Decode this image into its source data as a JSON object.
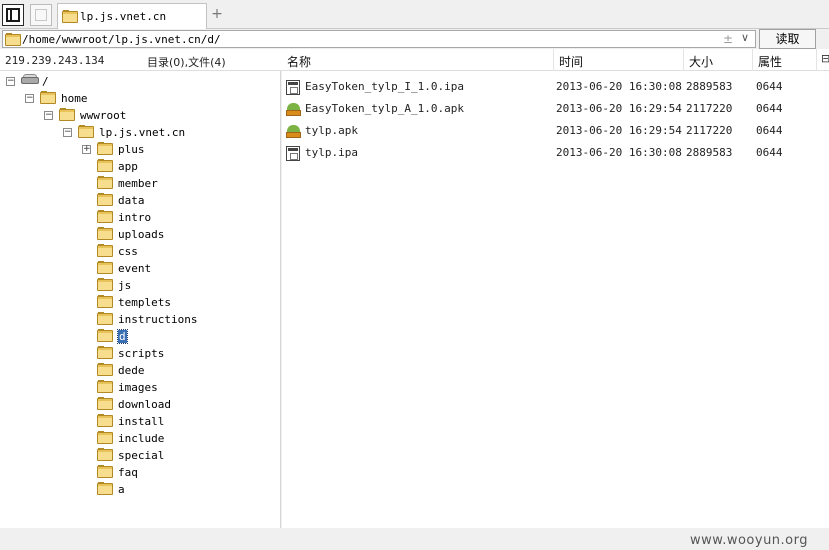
{
  "tab": {
    "label": "lp.js.vnet.cn",
    "add_label": "+"
  },
  "address": {
    "path": "/home/wwwroot/lp.js.vnet.cn/d/",
    "plus_glyph": "±",
    "dropdown_glyph": "∨",
    "read_label": "读取"
  },
  "status": {
    "ip": "219.239.243.134",
    "counts": "目录(0),文件(4)"
  },
  "columns": {
    "name": "名称",
    "time": "时间",
    "size": "大小",
    "attr": "属性",
    "end_glyph": "⊟"
  },
  "tree": {
    "root": "/",
    "home": "home",
    "wwwroot": "wwwroot",
    "site": "lp.js.vnet.cn",
    "expand_plus": "+",
    "expand_minus": "−",
    "folders": [
      "plus",
      "app",
      "member",
      "data",
      "intro",
      "uploads",
      "css",
      "event",
      "js",
      "templets",
      "instructions",
      "d",
      "scripts",
      "dede",
      "images",
      "download",
      "install",
      "include",
      "special",
      "faq",
      "a"
    ]
  },
  "files": [
    {
      "name": "EasyToken_tylp_I_1.0.ipa",
      "time": "2013-06-20 16:30:08",
      "size": "2889583",
      "attr": "0644",
      "icon": "ipa-file-icon"
    },
    {
      "name": "EasyToken_tylp_A_1.0.apk",
      "time": "2013-06-20 16:29:54",
      "size": "2117220",
      "attr": "0644",
      "icon": "apk-file-icon"
    },
    {
      "name": "tylp.apk",
      "time": "2013-06-20 16:29:54",
      "size": "2117220",
      "attr": "0644",
      "icon": "apk-file-icon"
    },
    {
      "name": "tylp.ipa",
      "time": "2013-06-20 16:30:08",
      "size": "2889583",
      "attr": "0644",
      "icon": "ipa-file-icon"
    }
  ],
  "watermark": "www.wooyun.org"
}
